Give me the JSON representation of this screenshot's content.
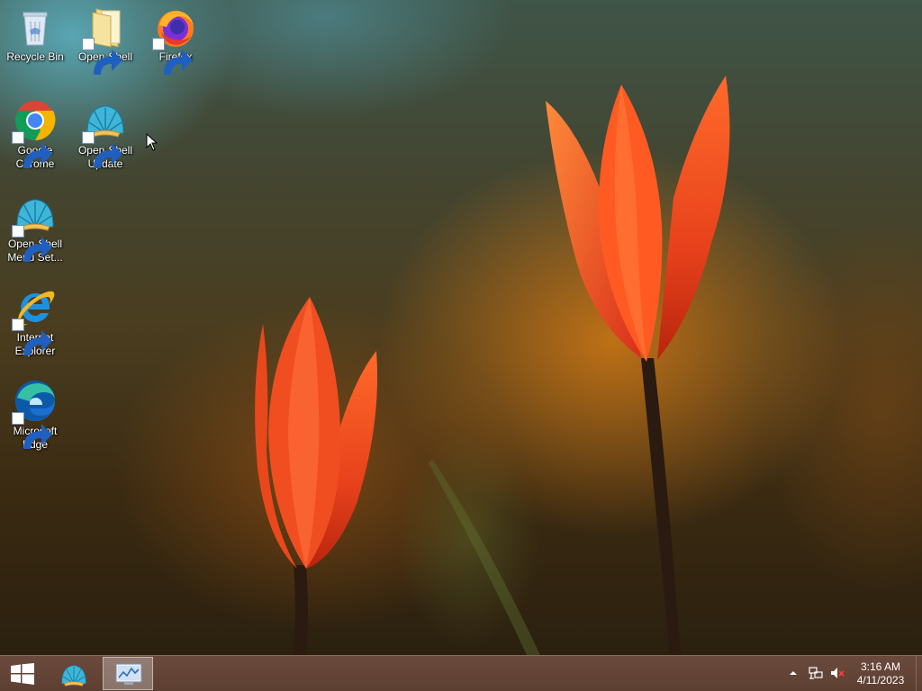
{
  "desktop": {
    "icons": [
      {
        "label": "Recycle Bin",
        "icon": "recycle-bin-icon"
      },
      {
        "label": "Open-Shell",
        "icon": "folder-icon"
      },
      {
        "label": "Firefox",
        "icon": "firefox-icon"
      },
      {
        "label": "Google Chrome",
        "icon": "chrome-icon"
      },
      {
        "label": "Open-Shell Update",
        "icon": "open-shell-icon"
      },
      {
        "label": "Open-Shell Menu Set...",
        "icon": "open-shell-icon"
      },
      {
        "label": "Internet Explorer",
        "icon": "internet-explorer-icon"
      },
      {
        "label": "Microsoft Edge",
        "icon": "edge-icon"
      }
    ]
  },
  "taskbar": {
    "start_icon": "windows-logo-icon",
    "pinned": [
      {
        "icon": "open-shell-icon",
        "active": false
      },
      {
        "icon": "task-manager-icon",
        "active": true
      }
    ],
    "tray": {
      "icons": [
        "chevron-up-icon",
        "network-icon",
        "speaker-muted-icon"
      ],
      "time": "3:16 AM",
      "date": "4/11/2023"
    }
  },
  "colors": {
    "taskbar": "#5d3f31",
    "tulip": "#e8421c"
  }
}
